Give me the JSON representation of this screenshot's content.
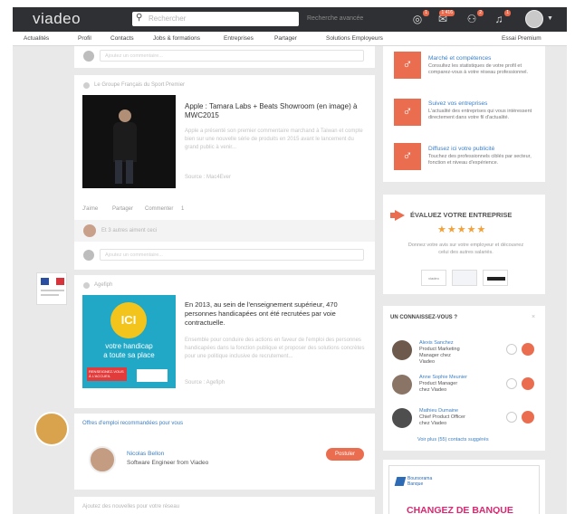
{
  "header": {
    "logo": "viadeo",
    "search_placeholder": "Rechercher",
    "advanced_search": "Recherche avancée",
    "badges": {
      "notifications": "1",
      "messages": "1 416",
      "contacts": "2",
      "alerts": "1"
    }
  },
  "menu": {
    "items": [
      "Actualités",
      "Profil",
      "Contacts",
      "Jobs & formations",
      "Entreprises",
      "Partager",
      "Solutions Employeurs"
    ],
    "premium": "Essai Premium"
  },
  "feed": {
    "top_comment_placeholder": "Ajoutez un commentaire...",
    "post1": {
      "source": "Le Groupe Français du Sport Premier",
      "title": "Apple : Tamara Labs + Beats Showroom (en image) à MWC2015",
      "excerpt": "Apple a présenté son premier commentaire marchand à Taiwan et compte bien sur une nouvelle série de produits en 2015 avant le lancement du grand public à venir...",
      "meta": "Source : Mac4Ever",
      "actions": {
        "like": "J'aime",
        "share": "Partager",
        "comment": "Commenter",
        "count": "1"
      },
      "liked_by": "Et 3 autres aiment ceci",
      "comment_placeholder": "Ajoutez un commentaire..."
    },
    "post2": {
      "source": "Agefiph",
      "image": {
        "badge": "ICI",
        "caption_line1": "votre handicap",
        "caption_line2": "a toute sa place",
        "ribbon": "RENSEIGNEZ-VOUS À L'ACCUEIL"
      },
      "title": "En 2013, au sein de l'enseignement supérieur, 470 personnes handicapées ont été recrutées par voie contractuelle.",
      "excerpt": "Ensemble pour conduire des actions en faveur de l'emploi des personnes handicapées dans la fonction publique et proposer des solutions concrètes pour une politique inclusive de recrutement...",
      "meta": "Source : Agefiph"
    },
    "post3": {
      "header": "Offres d'emploi recommandées pour vous",
      "person_name": "Nicolas Bellon",
      "person_role": "Software Engineer from Viadeo",
      "button": "Postuler"
    },
    "post4": {
      "header": "Ajoutez des nouvelles pour votre réseau"
    }
  },
  "sidebar": {
    "features": [
      {
        "title": "Marché et compétences",
        "text": "Consultez les statistiques de votre profil et comparez-vous à votre réseau professionnel."
      },
      {
        "title": "Suivez vos entreprises",
        "text": "L'actualité des entreprises qui vous intéressent directement dans votre fil d'actualité."
      },
      {
        "title": "Diffusez ici votre publicité",
        "text": "Touchez des professionnels ciblés par secteur, fonction et niveau d'expérience."
      }
    ],
    "evaluate": {
      "title": "ÉVALUEZ VOTRE ENTREPRISE",
      "stars": 4.5,
      "text": "Donnez votre avis sur votre employeur et découvrez celui des autres salariés.",
      "logos": [
        "viadeo",
        "",
        "apple"
      ]
    },
    "suggestions": {
      "title": "UN CONNAISSEZ-VOUS ?",
      "people": [
        {
          "name": "Alexis Sanchez",
          "role": "Product Marketing Manager chez Viadeo"
        },
        {
          "name": "Anne Sophie Meunier",
          "role": "Product Manager chez Viadeo"
        },
        {
          "name": "Mathieu Dumaine",
          "role": "Chief Product Officer chez Viadeo"
        }
      ],
      "more": "Voir plus (55) contacts suggérés"
    },
    "ad": {
      "brand": "Boursorama Banque",
      "headline": "CHANGEZ DE BANQUE"
    }
  },
  "colors": {
    "accent": "#eb6d4f",
    "topbar": "#2f3033",
    "link": "#3c7fc4",
    "background": "#e9e9e9"
  }
}
